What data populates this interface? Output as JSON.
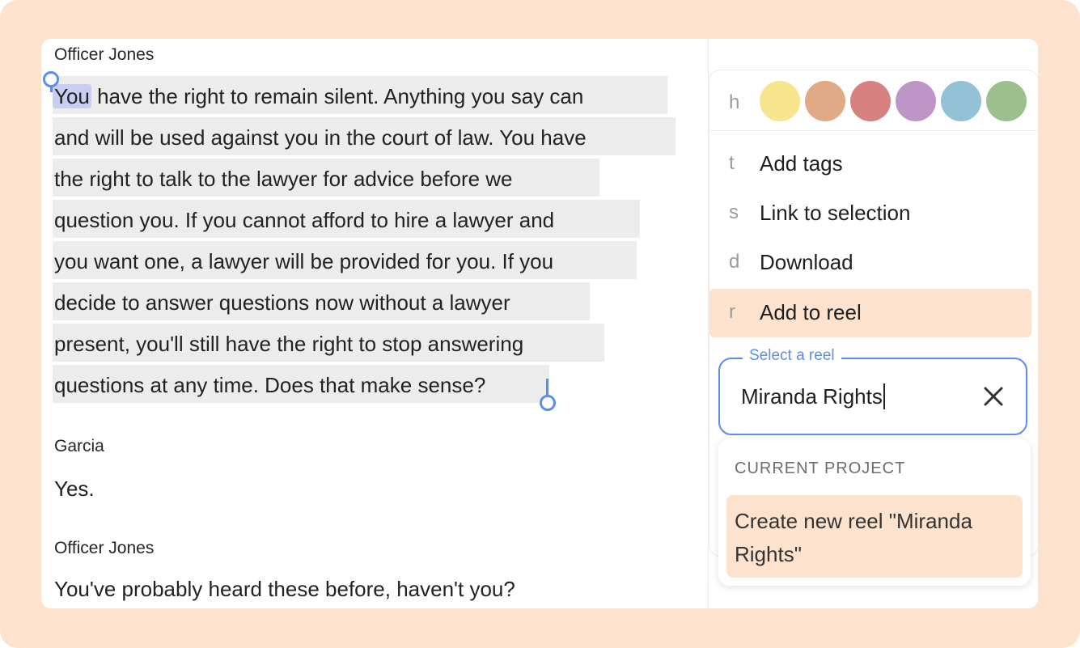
{
  "transcript": {
    "blocks": [
      {
        "speaker": "Officer Jones",
        "first_word": "You",
        "lines": [
          " have the right to remain silent. Anything you say can",
          "and will be used against you in the court of law. You have",
          "the right to talk to the lawyer for advice before we",
          "question you. If you cannot afford to hire a lawyer and",
          "you want one, a lawyer will be provided for you. If you",
          "decide to answer questions now without a lawyer",
          "present, you'll still have the right to stop answering",
          "questions at any time. Does that make sense?"
        ]
      },
      {
        "speaker": "Garcia",
        "text": "Yes."
      },
      {
        "speaker": "Officer Jones",
        "text": "You've probably heard these before, haven't you?"
      }
    ]
  },
  "menu": {
    "highlight_hotkey": "h",
    "colors": [
      {
        "name": "yellow",
        "hex": "#f7e58d"
      },
      {
        "name": "orange",
        "hex": "#dfaa85"
      },
      {
        "name": "red",
        "hex": "#d78080"
      },
      {
        "name": "purple",
        "hex": "#be95c6"
      },
      {
        "name": "blue",
        "hex": "#93c1d6"
      },
      {
        "name": "green",
        "hex": "#9bbf8d"
      }
    ],
    "items": [
      {
        "hotkey": "t",
        "label": "Add tags"
      },
      {
        "hotkey": "s",
        "label": "Link to selection"
      },
      {
        "hotkey": "d",
        "label": "Download"
      },
      {
        "hotkey": "r",
        "label": "Add to reel"
      }
    ]
  },
  "reel_select": {
    "legend": "Select a reel",
    "value": "Miranda Rights",
    "dropdown_heading": "CURRENT PROJECT",
    "create_option": "Create new reel \"Miranda Rights\""
  },
  "colors": {
    "accent": "#5b8def",
    "peach": "#fde3cd",
    "selection": "#ececec",
    "word_highlight": "#c9cdf2"
  }
}
